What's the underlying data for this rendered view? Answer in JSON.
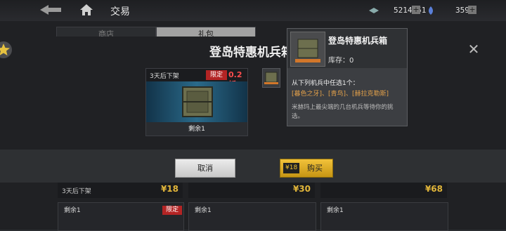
{
  "header": {
    "title": "交易",
    "currency_a": "5214151",
    "currency_b": "3591",
    "plus_label": "+"
  },
  "bg_tabs": [
    "商店",
    "礼包"
  ],
  "dialog": {
    "title": "登岛特惠机兵箱",
    "close_label": "✕",
    "card": {
      "time_label": "3天后下架",
      "limited_label": "限定",
      "discount_label": "0.2折",
      "remaining_label": "剩余1"
    },
    "cancel_label": "取消",
    "buy_price": "¥18",
    "buy_label": "购买"
  },
  "tooltip": {
    "name": "登岛特惠机兵箱",
    "stock": "库存：0",
    "intro": "从下列机兵中任选1个：",
    "items": "[暮色之牙]、[青鸟]、[赫拉克勒斯]",
    "desc": "米赫玛上最尖端的几台机兵等待你的挑选。"
  },
  "grid": {
    "row1": [
      {
        "time": "3天后下架",
        "price": "¥18"
      },
      {
        "time": "",
        "price": "¥30"
      },
      {
        "time": "",
        "price": "¥68"
      }
    ],
    "row2": [
      {
        "remaining": "剩余1",
        "limited": "限定"
      },
      {
        "remaining": "剩余1",
        "limited": ""
      },
      {
        "remaining": "剩余1",
        "limited": ""
      }
    ]
  },
  "colors": {
    "accent_gold": "#e2b63a",
    "badge_red": "#b32424",
    "item_orange": "#e2a04a"
  }
}
